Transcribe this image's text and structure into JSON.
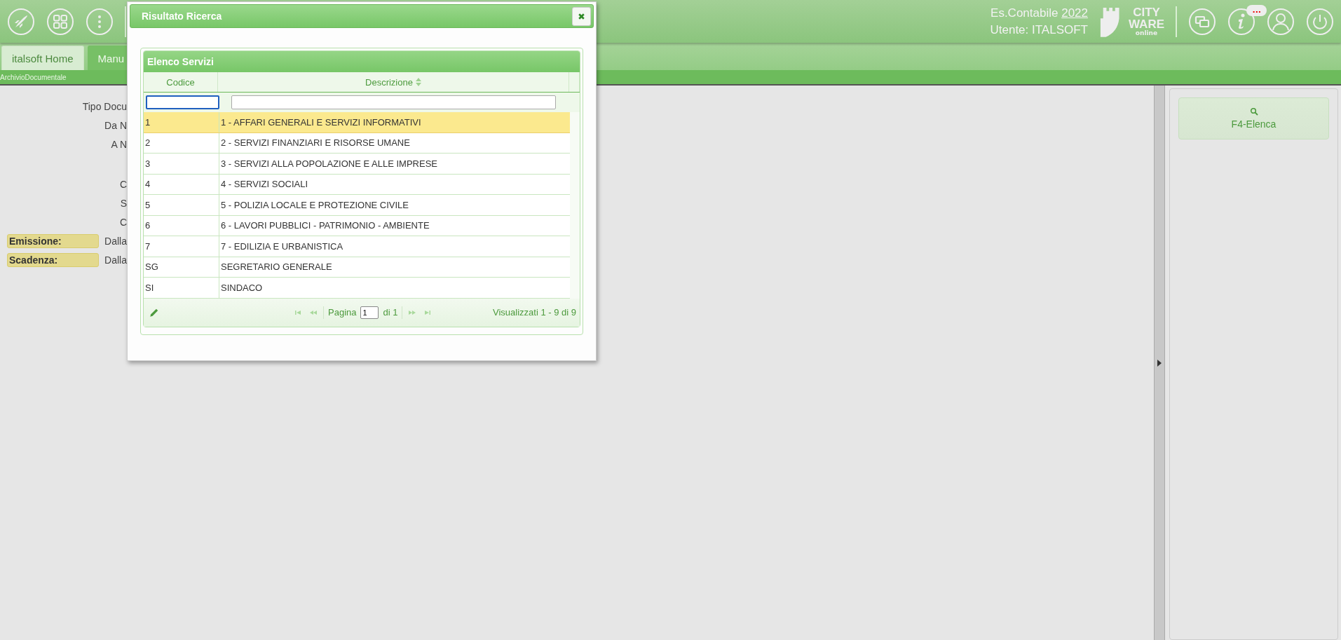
{
  "header": {
    "fiscal_year_label": "Es.Contabile",
    "fiscal_year": "2022",
    "user": "Utente: ITALSOFT",
    "logo_lines": [
      "CITY",
      "WARE"
    ],
    "logo_sub": "online",
    "notification_badge": "..."
  },
  "tabs": [
    {
      "label": "italsoft Home",
      "selected": false
    },
    {
      "label": "Manu",
      "selected": true
    }
  ],
  "breadcrumb": "ArchivioDocumentale",
  "form_rows": [
    {
      "kind": "plain",
      "label": "Tipo Docu"
    },
    {
      "kind": "plain",
      "label": "Da N"
    },
    {
      "kind": "plain",
      "label": "A N"
    },
    {
      "kind": "gap"
    },
    {
      "kind": "plain",
      "label": "C"
    },
    {
      "kind": "plain",
      "label": "S"
    },
    {
      "kind": "plain",
      "label": "C"
    },
    {
      "kind": "section",
      "label": "Emissione:",
      "value": "Dalla"
    },
    {
      "kind": "section",
      "label": "Scadenza:",
      "value": "Dalla"
    }
  ],
  "dialog": {
    "title": "Risultato Ricerca",
    "grid": {
      "title": "Elenco Servizi",
      "columns": [
        "Codice",
        "Descrizione"
      ],
      "rows": [
        {
          "code": "1",
          "description": "1 - AFFARI GENERALI E SERVIZI INFORMATIVI",
          "selected": true
        },
        {
          "code": "2",
          "description": "2 - SERVIZI FINANZIARI E RISORSE UMANE",
          "selected": false
        },
        {
          "code": "3",
          "description": "3 - SERVIZI ALLA POPOLAZIONE E ALLE IMPRESE",
          "selected": false
        },
        {
          "code": "4",
          "description": "4 - SERVIZI SOCIALI",
          "selected": false
        },
        {
          "code": "5",
          "description": "5 - POLIZIA LOCALE E PROTEZIONE CIVILE",
          "selected": false
        },
        {
          "code": "6",
          "description": "6 - LAVORI PUBBLICI - PATRIMONIO - AMBIENTE",
          "selected": false
        },
        {
          "code": "7",
          "description": "7 - EDILIZIA E URBANISTICA",
          "selected": false
        },
        {
          "code": "SG",
          "description": "SEGRETARIO GENERALE",
          "selected": false
        },
        {
          "code": "SI",
          "description": "SINDACO",
          "selected": false
        }
      ],
      "pager": {
        "page_label": "Pagina",
        "page": "1",
        "of_label": "di 1",
        "summary": "Visualizzati 1 - 9 di 9"
      }
    }
  },
  "side_panel": {
    "button": "F4-Elenca"
  }
}
